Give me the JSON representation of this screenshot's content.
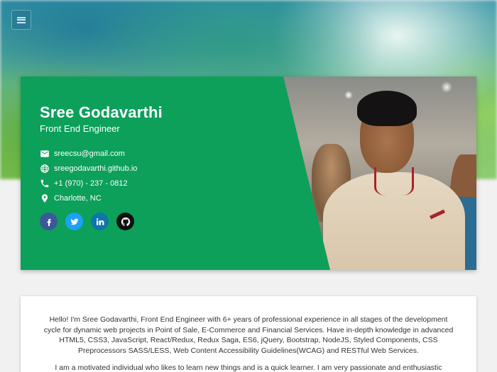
{
  "nav": {
    "menu_icon": "hamburger-menu-icon"
  },
  "profile": {
    "name": "Sree Godavarthi",
    "title": "Front End Engineer",
    "contacts": [
      {
        "icon": "email-icon",
        "text": "sreecsu@gmail.com"
      },
      {
        "icon": "globe-icon",
        "text": "sreegodavarthi.github.io"
      },
      {
        "icon": "phone-icon",
        "text": "+1 (970) - 237 - 0812"
      },
      {
        "icon": "location-pin-icon",
        "text": "Charlotte, NC"
      }
    ],
    "socials": [
      {
        "icon": "facebook-icon",
        "glyph": "f",
        "color": "#3b5998"
      },
      {
        "icon": "twitter-icon",
        "glyph": "t",
        "color": "#1da1f2"
      },
      {
        "icon": "linkedin-icon",
        "glyph": "in",
        "color": "#0e76a8"
      },
      {
        "icon": "github-icon",
        "glyph": "",
        "color": "#111111"
      }
    ],
    "card_color": "#0ca05a"
  },
  "about": {
    "paragraphs": [
      "Hello! I'm Sree Godavarthi, Front End Engineer with 6+ years of professional experience in all stages of the development cycle for dynamic web projects in Point of Sale, E-Commerce and Financial Services. Have in-depth knowledge in advanced HTML5, CSS3, JavaScript, React/Redux, Redux Saga, ES6, jQuery, Bootstrap, NodeJS, Styled Components, CSS Preprocessors SASS/LESS, Web Content Accessibility Guidelines(WCAG) and RESTful Web Services.",
      "I am a motivated individual who likes to learn new things and is a quick learner. I am very passionate and enthusiastic"
    ]
  }
}
